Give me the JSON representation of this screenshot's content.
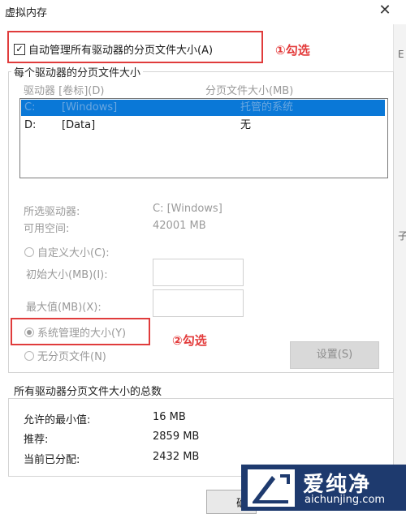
{
  "window": {
    "title": "虚拟内存"
  },
  "auto_manage": {
    "label": "自动管理所有驱动器的分页文件大小(A)"
  },
  "annotations": {
    "first": "①勾选",
    "second": "②勾选"
  },
  "per_drive": {
    "group_label": "每个驱动器的分页文件大小",
    "col_drive": "驱动器 [卷标](D)",
    "col_size": "分页文件大小(MB)",
    "rows": [
      {
        "drive": "C:",
        "label": "[Windows]",
        "size": "托管的系统"
      },
      {
        "drive": "D:",
        "label": "[Data]",
        "size": "无"
      }
    ],
    "selected_drive_label": "所选驱动器:",
    "selected_drive_value": "C:  [Windows]",
    "free_space_label": "可用空间:",
    "free_space_value": "42001 MB",
    "custom_size": "自定义大小(C):",
    "initial_size": "初始大小(MB)(I):",
    "max_size": "最大值(MB)(X):",
    "system_managed": "系统管理的大小(Y)",
    "no_paging": "无分页文件(N)",
    "set_button": "设置(S)"
  },
  "totals": {
    "group_label": "所有驱动器分页文件大小的总数",
    "min_allowed_label": "允许的最小值:",
    "min_allowed_value": "16 MB",
    "recommended_label": "推荐:",
    "recommended_value": "2859 MB",
    "current_label": "当前已分配:",
    "current_value": "2432 MB"
  },
  "bottom": {
    "ok_partial": "确"
  },
  "right_edge": {
    "char1": "E",
    "char2": "子"
  },
  "watermark": {
    "brand": "爱纯净",
    "url": "aichunjing.com"
  },
  "colors": {
    "annotation_red": "#e03c3c",
    "selection_blue": "#0a78d7",
    "logo_bg": "#1e3a6e"
  }
}
